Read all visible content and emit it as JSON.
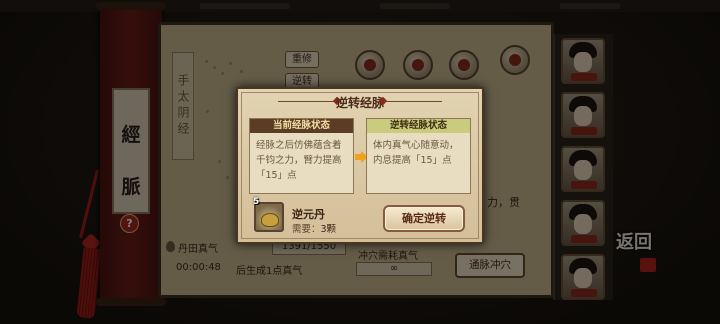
{
  "left_scroll": {
    "char_top": "經",
    "char_bottom": "脈",
    "help": "?"
  },
  "background": {
    "meridian_name": "手太阴经",
    "rebuild_button": "重修",
    "reverse_button": "逆转",
    "partial_text": "力，贯",
    "dantian": {
      "label": "丹田真气",
      "value": "1391/1550"
    },
    "timer": {
      "time": "00:00:48",
      "text": "后生成1点真气"
    },
    "acupoint_cost": {
      "label": "冲穴需耗真气",
      "value": "∞"
    },
    "breakthrough_button": "通脉冲穴",
    "back_label": "返回"
  },
  "dialog": {
    "title": "逆转经脉",
    "current": {
      "header": "当前经脉状态",
      "text": "经脉之后仿佛蕴含着千钧之力，臂力提高「15」点"
    },
    "reversed": {
      "header": "逆转经脉状态",
      "text": "体内真气心随意动，内息提高「15」点"
    },
    "item": {
      "name": "逆元丹",
      "count": "5",
      "require_label": "需要：",
      "require_value": "3颗"
    },
    "confirm_button": "确定逆转"
  },
  "colors": {
    "parchment": "#cbb891",
    "dialog_bg": "#e2d3b2",
    "accent_arrow": "#f0a21e",
    "seal_red": "#b0271c"
  }
}
